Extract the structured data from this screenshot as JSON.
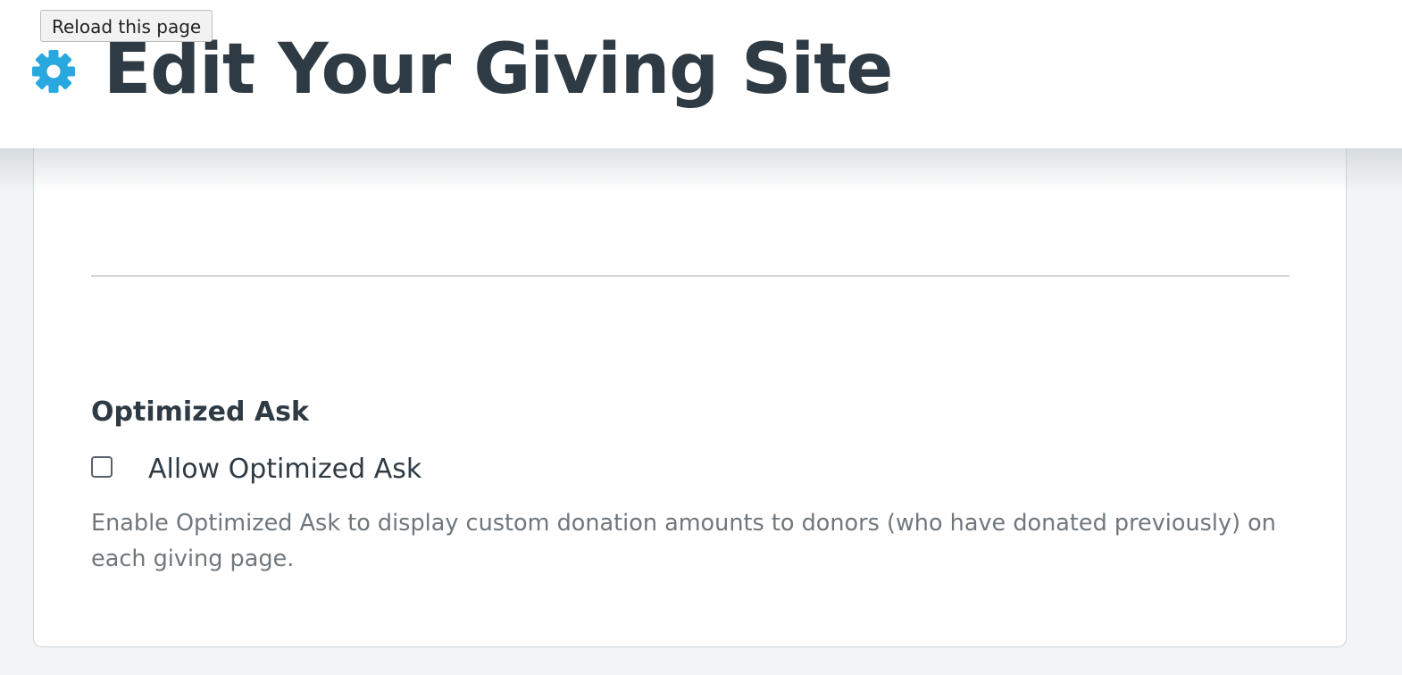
{
  "tooltip": {
    "text": "Reload this page"
  },
  "header": {
    "title": "Edit Your Giving Site",
    "icon": "gear-icon",
    "icon_color": "#29a8e0"
  },
  "optimized_ask": {
    "heading": "Optimized Ask",
    "checkbox_label": "Allow Optimized Ask",
    "checked": false,
    "help_text": "Enable Optimized Ask to display custom donation amounts to donors (who have donated previously) on each giving page."
  }
}
